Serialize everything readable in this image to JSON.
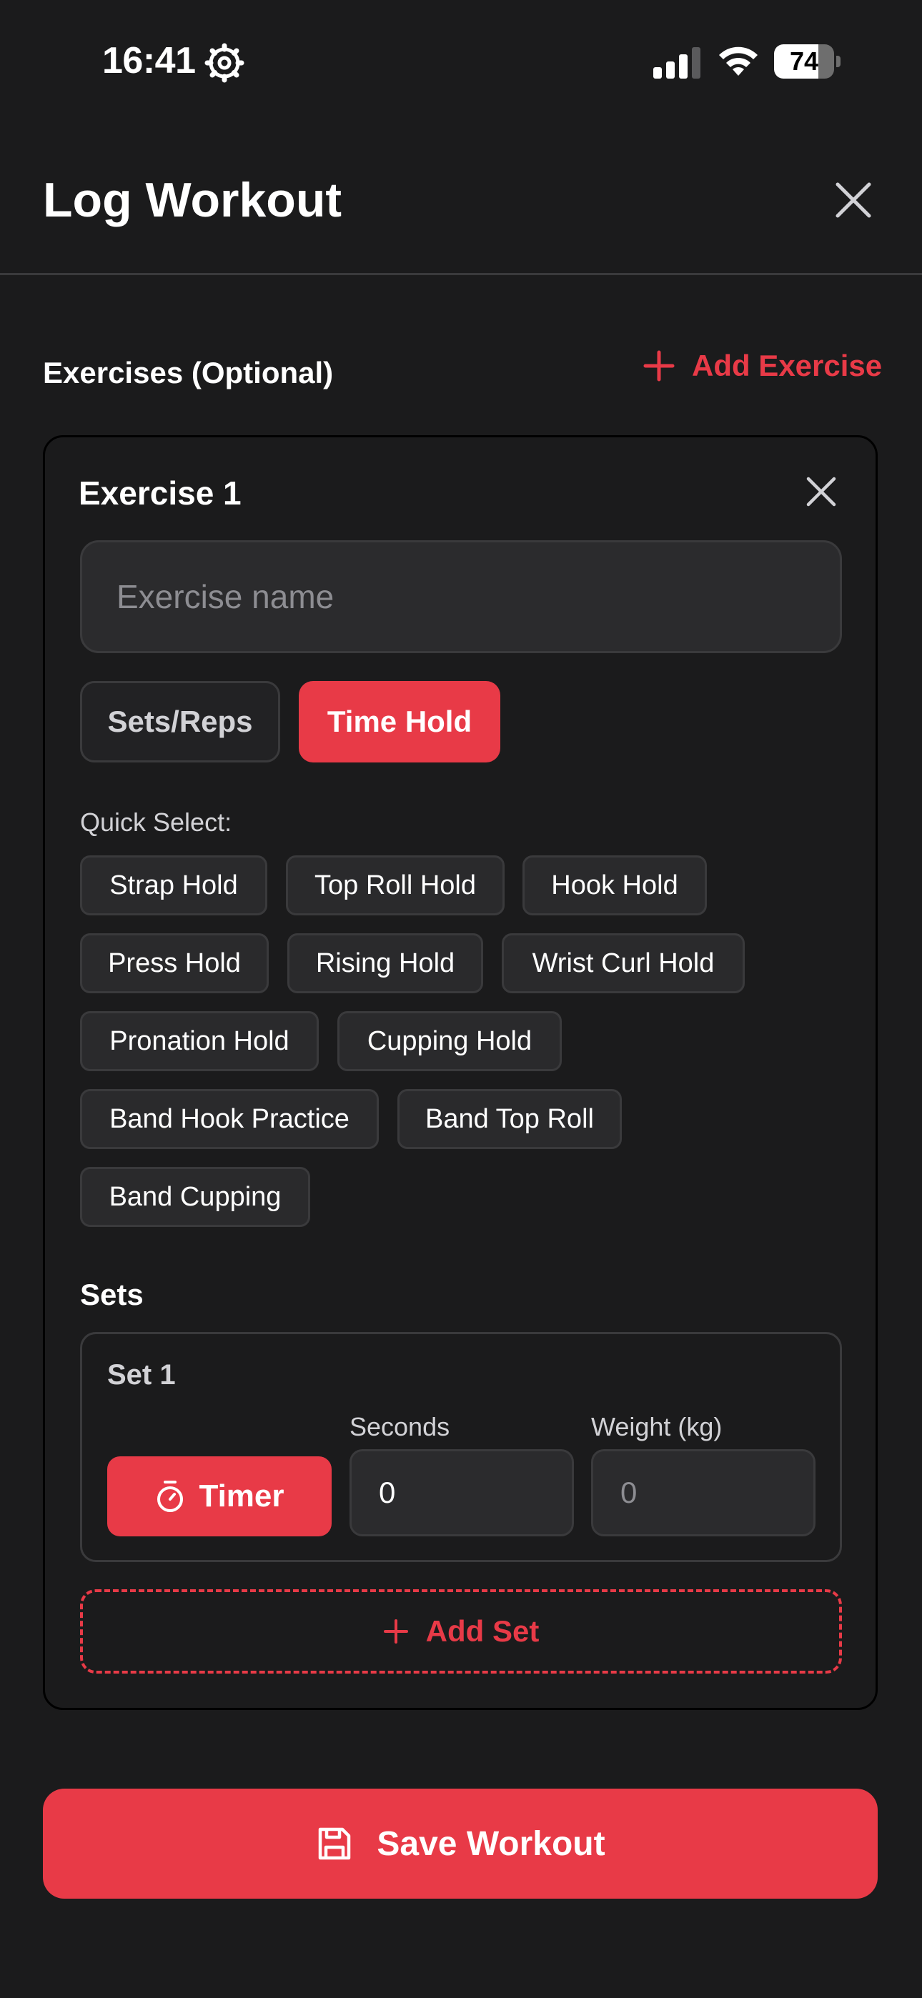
{
  "status_bar": {
    "time": "16:41",
    "battery_percent": "74",
    "battery_level": 0.74,
    "icons": [
      "gear-icon",
      "cellular-signal-icon",
      "wifi-icon",
      "battery-icon"
    ]
  },
  "header": {
    "title": "Log Workout",
    "close_icon": "close-icon"
  },
  "exercises_section": {
    "label": "Exercises (Optional)",
    "add_exercise_label": "Add Exercise",
    "add_icon": "plus-icon"
  },
  "exercise_card": {
    "title": "Exercise 1",
    "name_placeholder": "Exercise name",
    "name_value": "",
    "modes": [
      {
        "label": "Sets/Reps",
        "selected": false
      },
      {
        "label": "Time Hold",
        "selected": true
      }
    ],
    "quick_select_label": "Quick Select:",
    "quick_select": [
      "Strap Hold",
      "Top Roll Hold",
      "Hook Hold",
      "Press Hold",
      "Rising Hold",
      "Wrist Curl Hold",
      "Pronation Hold",
      "Cupping Hold",
      "Band Hook Practice",
      "Band Top Roll",
      "Band Cupping"
    ],
    "sets_label": "Sets",
    "sets": [
      {
        "title": "Set 1",
        "timer_label": "Timer",
        "seconds_label": "Seconds",
        "seconds_value": "0",
        "weight_label": "Weight (kg)",
        "weight_placeholder": "0"
      }
    ],
    "add_set_label": "Add Set"
  },
  "save_button": {
    "label": "Save Workout",
    "icon": "save-icon"
  },
  "colors": {
    "background": "#1b1b1c",
    "accent": "#e83a47",
    "surface": "#2b2b2d",
    "border": "#3a3a3c"
  }
}
